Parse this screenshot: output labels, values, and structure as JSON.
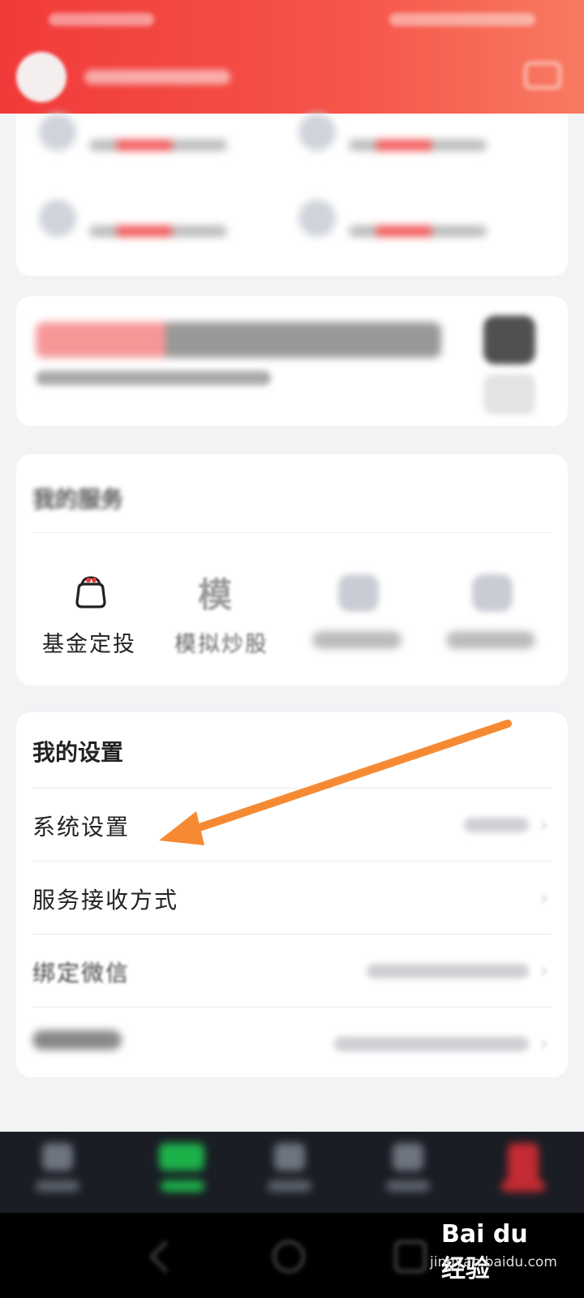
{
  "funds": [
    {
      "name": "",
      "slot": 0
    },
    {
      "name": "",
      "slot": 1
    },
    {
      "name": "",
      "slot": 2
    },
    {
      "name": "",
      "slot": 3
    }
  ],
  "banner": {
    "title_red": "",
    "title_dark": "",
    "subtitle": ""
  },
  "services": {
    "title": "我的服务",
    "items": [
      {
        "label": "基金定投",
        "icon": "wallet-icon"
      },
      {
        "label": "模拟炒股",
        "icon": "mo-glyph-icon"
      },
      {
        "label": "",
        "icon": "blurred-service-icon"
      },
      {
        "label": "",
        "icon": "blurred-service-icon"
      }
    ],
    "mo_glyph": "模"
  },
  "settings": {
    "title": "我的设置",
    "items": [
      {
        "label": "系统设置"
      },
      {
        "label": "服务接收方式"
      },
      {
        "label": "绑定微信"
      },
      {
        "label": ""
      }
    ]
  },
  "watermark": {
    "logo": "Bai du 经验",
    "url": "jingyan.baidu.com"
  },
  "colors": {
    "header_red": "#f13a3a",
    "arrow_orange": "#f58a33",
    "tab_green": "#1cb24a",
    "tab_red": "#c52b32"
  }
}
